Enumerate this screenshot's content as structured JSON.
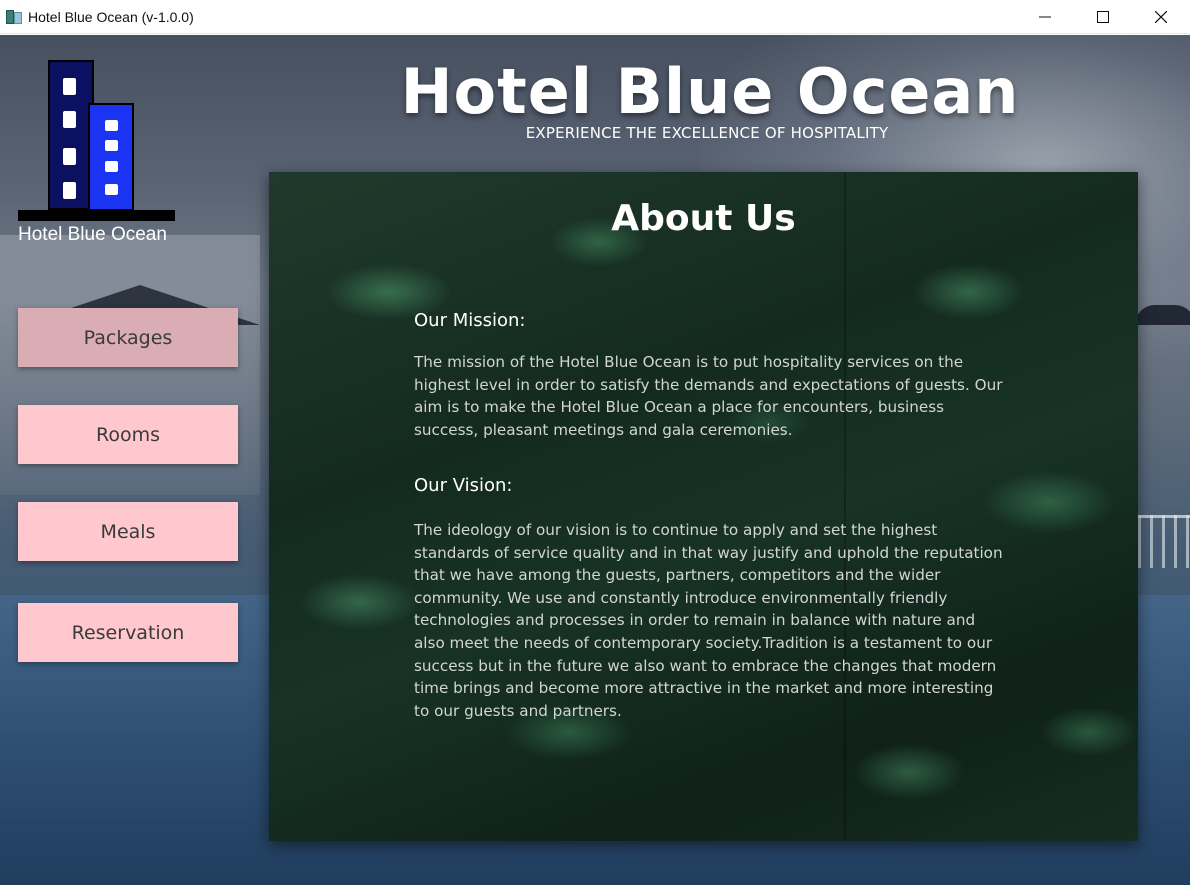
{
  "window": {
    "title": "Hotel Blue Ocean (v-1.0.0)",
    "controls": [
      "minimize-icon",
      "maximize-icon",
      "close-icon"
    ]
  },
  "logo": {
    "text": "Hotel Blue Ocean",
    "colors": {
      "back_tower": "#0b1160",
      "front_tower": "#1b34f2",
      "base": "#000000"
    }
  },
  "nav": {
    "items": [
      {
        "label": "Packages",
        "active": true
      },
      {
        "label": "Rooms",
        "active": false
      },
      {
        "label": "Meals",
        "active": false
      },
      {
        "label": "Reservation",
        "active": false
      }
    ],
    "colors": {
      "button": "#ffc7ce",
      "button_active": "#d9adb3",
      "text": "#3a3a3a"
    }
  },
  "header": {
    "title": "Hotel Blue Ocean",
    "subtitle": "EXPERIENCE THE EXCELLENCE OF HOSPITALITY"
  },
  "about": {
    "title": "About Us",
    "mission_heading": "Our Mission:",
    "mission_text": "The mission of the Hotel Blue Ocean is to put hospitality services on the highest level in order to satisfy the demands and expectations of guests. Our aim is to make the Hotel Blue Ocean a place for encounters, business success, pleasant meetings and gala ceremonies.",
    "vision_heading": "Our Vision:",
    "vision_text": "The ideology of our vision is to continue to apply and set the highest standards of service quality and in that way justify and uphold the reputation that we have among the guests, partners, competitors and the wider community. We use and constantly introduce environmentally friendly technologies and processes in order to remain in balance with nature and also meet the needs of contemporary society.Tradition is a testament to our success but in the future we also want to embrace the changes that modern time brings and become more attractive in the market and more interesting to our guests and partners."
  }
}
